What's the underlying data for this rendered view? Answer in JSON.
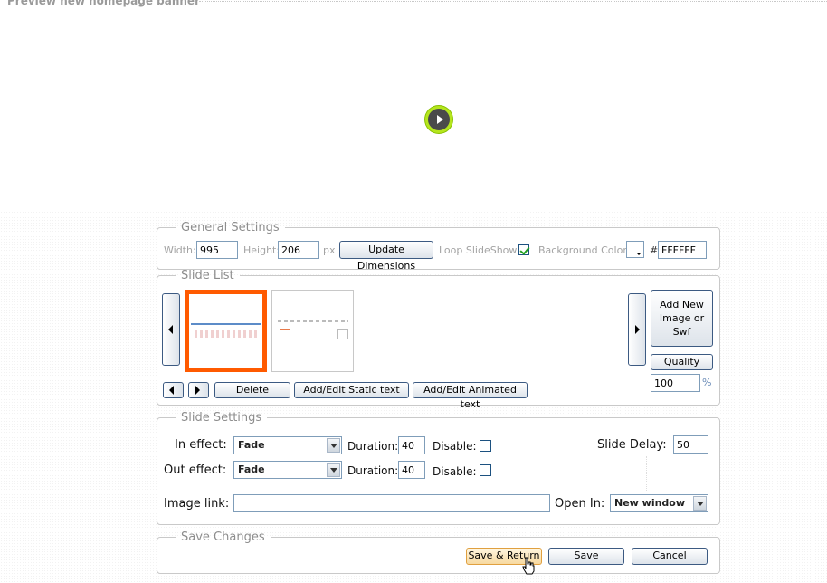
{
  "preview": {
    "title": "Preview  new homepage banner"
  },
  "general_settings": {
    "legend": "General Settings",
    "width_label": "Width:",
    "width_value": "995",
    "height_label": "Height:",
    "height_value": "206",
    "px_label": "px",
    "update_button": "Update Dimensions",
    "loop_label": "Loop SlideShow:",
    "loop_checked": true,
    "bg_color_label": "Background Color:",
    "hash": "#",
    "bg_color_value": "FFFFFF"
  },
  "slide_list": {
    "legend": "Slide List",
    "add_new_button": "Add New Image or Swf",
    "quality_button": "Quality",
    "quality_value": "100",
    "percent": "%",
    "delete_button": "Delete",
    "static_text_button": "Add/Edit Static text",
    "animated_text_button": "Add/Edit Animated text",
    "thumbnails": [
      {
        "selected": true
      },
      {
        "selected": false
      }
    ],
    "accent_color": "#ff5a00"
  },
  "slide_settings": {
    "legend": "Slide Settings",
    "in_effect_label": "In effect:",
    "in_effect_value": "Fade",
    "out_effect_label": "Out effect:",
    "out_effect_value": "Fade",
    "duration_label": "Duration:",
    "in_duration": "40",
    "out_duration": "40",
    "disable_label": "Disable:",
    "slide_delay_label": "Slide Delay:",
    "slide_delay_value": "50",
    "image_link_label": "Image link:",
    "image_link_value": "",
    "open_in_label": "Open In:",
    "open_in_value": "New window"
  },
  "save_changes": {
    "legend": "Save Changes",
    "save_return_button": "Save & Return",
    "save_button": "Save",
    "cancel_button": "Cancel"
  }
}
